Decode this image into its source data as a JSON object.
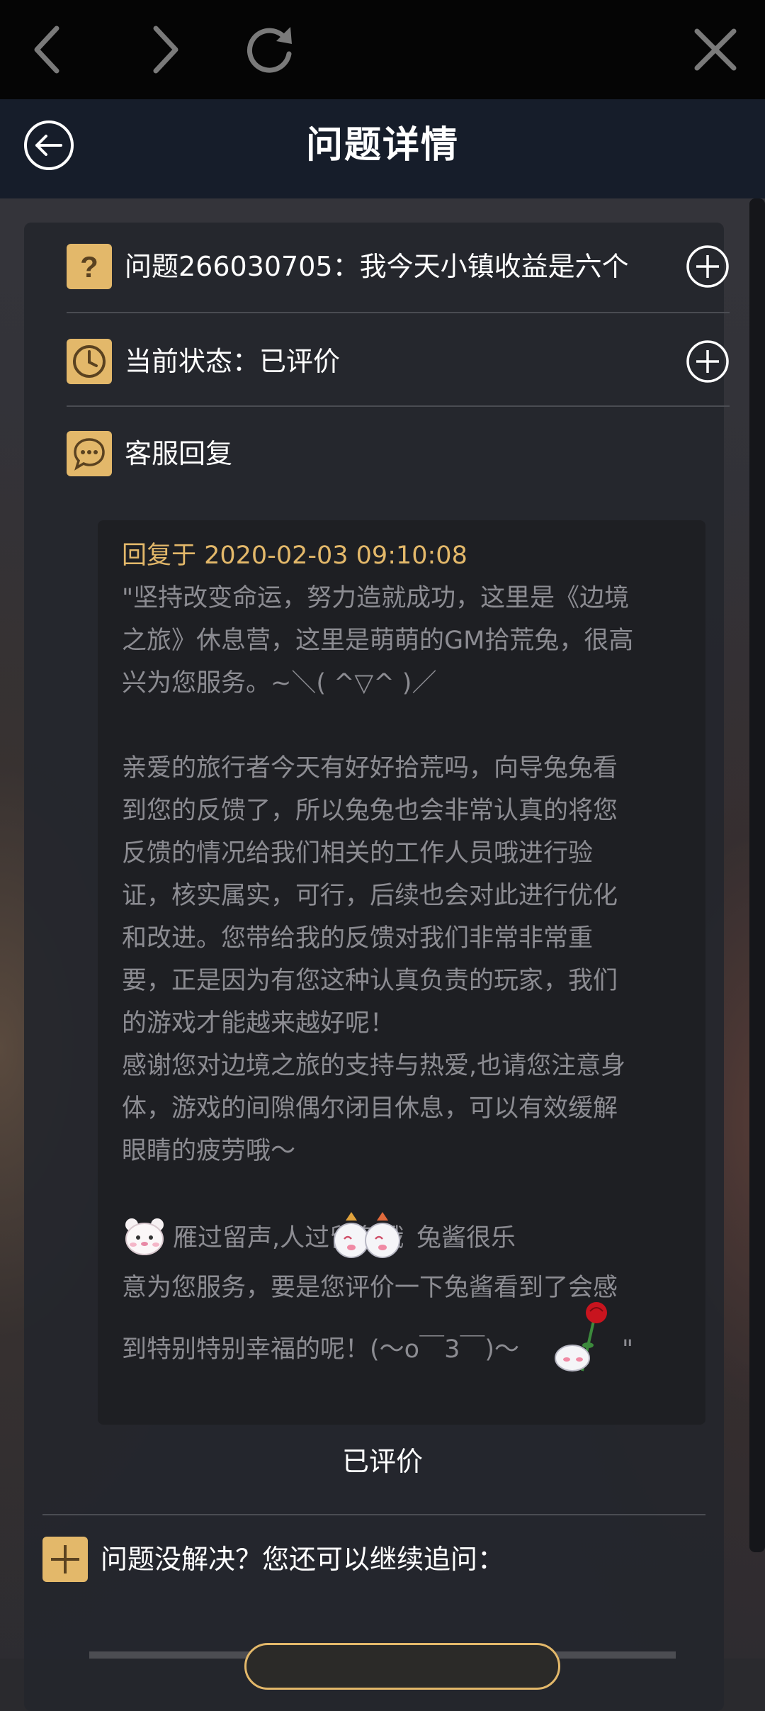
{
  "browser": {
    "back_icon": "chevron-left-icon",
    "forward_icon": "chevron-right-icon",
    "reload_icon": "refresh-icon",
    "close_icon": "close-icon"
  },
  "header": {
    "title": "问题详情",
    "back_icon": "arrow-left-circle-icon"
  },
  "question": {
    "label": "问题266030705：我今天小镇收益是六个",
    "icon": "question-mark-icon"
  },
  "status": {
    "label": "当前状态：已评价",
    "icon": "clock-icon"
  },
  "service": {
    "label": "客服回复",
    "icon": "chat-bubble-icon"
  },
  "reply": {
    "time": "回复于 2020-02-03 09:10:08",
    "lines": [
      "\"坚持改变命运，努力造就成功，这里是《边境",
      "之旅》休息营，这里是萌萌的GM拾荒兔，很高",
      "兴为您服务。~＼( ^▽^ )／",
      "",
      "亲爱的旅行者今天有好好拾荒吗，向导兔兔看",
      "到您的反馈了，所以兔兔也会非常认真的将您",
      "反馈的情况给我们相关的工作人员哦进行验",
      "证，核实属实，可行，后续也会对此进行优化",
      "和改进。您带给我的反馈对我们非常非常重",
      "要，正是因为有您这种认真负责的玩家，我们",
      "的游戏才能越来越好呢！",
      "感谢您对边境之旅的支持与热爱,也请您注意身",
      "体，游戏的间隙偶尔闭目休息，可以有效缓解",
      "眼睛的疲劳哦～"
    ],
    "sticker_line_a": "雁过留声,人过留名哦",
    "sticker_line_b": "兔酱很乐",
    "line_after": "意为您服务，要是您评价一下兔酱看到了会感",
    "last_line": "到特别特别幸福的呢！(～o￣3￣)～",
    "closing_quote": "\""
  },
  "rated_label": "已评价",
  "follow_up": {
    "label": "问题没解决？您还可以继续追问：",
    "icon": "plus-icon"
  },
  "colors": {
    "accent": "#e3b86a",
    "header_bg": "#161d2a",
    "card_bg": "#24262c",
    "reply_text": "#8c8c92"
  }
}
